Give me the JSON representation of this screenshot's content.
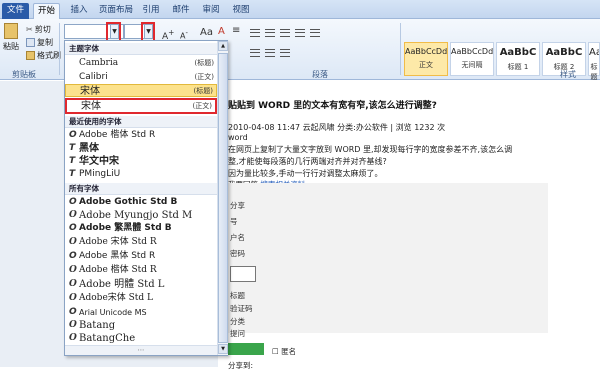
{
  "tabs": [
    "文件",
    "开始",
    "插入",
    "页面布局",
    "引用",
    "邮件",
    "审阅",
    "视图"
  ],
  "clipboard": {
    "paste": "粘贴",
    "cut": "剪切",
    "copy": "复制",
    "format_painter": "格式刷",
    "group": "剪贴板"
  },
  "paragraph_group": "段落",
  "styles_group": "样式",
  "styles": [
    {
      "preview": "AaBbCcDd",
      "name": "正文"
    },
    {
      "preview": "AaBbCcDd",
      "name": "无间隔"
    },
    {
      "preview": "AaBbC",
      "name": "标题 1"
    },
    {
      "preview": "AaBbC",
      "name": "标题 2"
    },
    {
      "preview": "AaBbC",
      "name": "标题"
    }
  ],
  "font_menu": {
    "theme_header": "主题字体",
    "theme_fonts": [
      {
        "name": "Cambria",
        "tag": "(标题)"
      },
      {
        "name": "Calibri",
        "tag": "(正文)"
      },
      {
        "name": "宋体",
        "tag": "(标题)"
      },
      {
        "name": "宋体",
        "tag": "(正文)"
      }
    ],
    "recent_header": "最近使用的字体",
    "recent_fonts": [
      "Adobe 楷体 Std R",
      "黑体",
      "华文中宋",
      "PMingLiU"
    ],
    "all_header": "所有字体",
    "all_fonts": [
      "Adobe Gothic Std B",
      "Adobe Myungjo Std M",
      "Adobe 繁黑體 Std B",
      "Adobe 宋体 Std R",
      "Adobe 黑体 Std R",
      "Adobe 楷体 Std R",
      "Adobe 明體 Std L",
      "Adobe宋体 Std L",
      "Arial Unicode MS",
      "Batang",
      "BatangChe"
    ]
  },
  "document": {
    "title": "贴贴到 WORD 里的文本有宽有窄,该怎么进行调整?",
    "meta": "2010-04-08 11:47  云起风啸  分类:办公软件 | 浏览 1232 次",
    "tag": "word",
    "body1": "在网页上复制了大量文字放到 WORD 里,却发现每行字的宽度参差不齐,该怎么调",
    "body2": "整,才能使每段落的几行两端对齐并对齐基线?",
    "body3": "因为量比较多,手动一行行对调整太麻烦了。",
    "search_prefix": "我要回答",
    "search_link": "搜索相关资料",
    "form_labels": [
      "分享",
      "号",
      "户名",
      "密码",
      "标题",
      "验证码",
      "分类",
      "提问",
      "匿名"
    ],
    "anon": "匿名",
    "bottom": "分享到:"
  }
}
